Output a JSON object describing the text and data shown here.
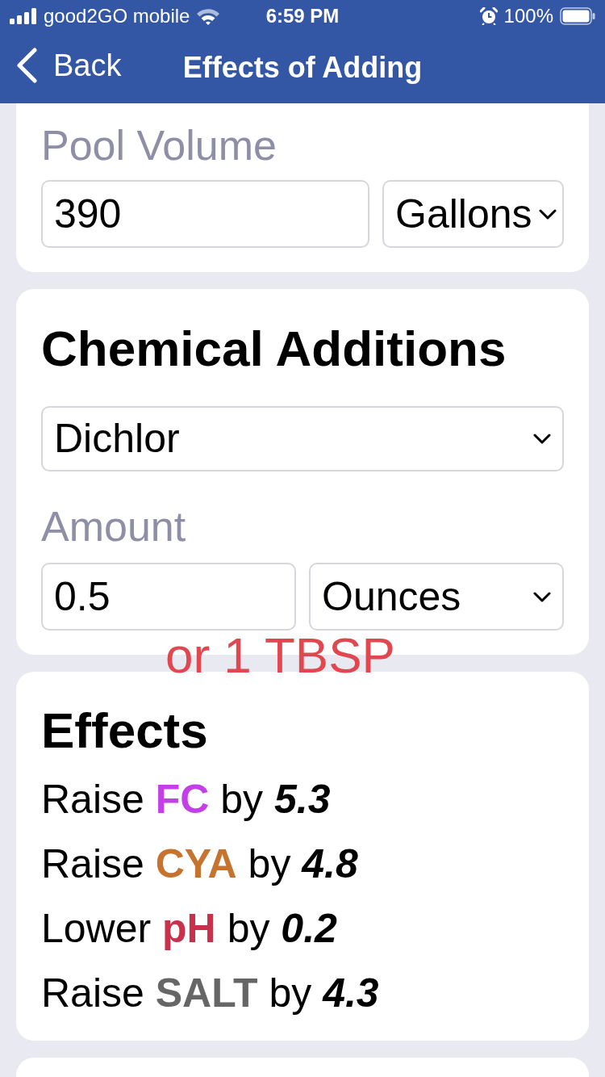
{
  "status_bar": {
    "carrier": "good2GO mobile",
    "time": "6:59 PM",
    "battery": "100%"
  },
  "nav_bar": {
    "back": "Back",
    "title": "Effects of Adding"
  },
  "pool_volume": {
    "label": "Pool Volume",
    "value": "390",
    "unit": "Gallons"
  },
  "chemical_additions": {
    "title": "Chemical Additions",
    "chemical": "Dichlor",
    "amount_label": "Amount",
    "amount": "0.5",
    "unit": "Ounces",
    "hint": "or 1 TBSP"
  },
  "effects": {
    "title": "Effects",
    "items": [
      {
        "verb": "Raise",
        "parameter": "FC",
        "color": "#c33fe8",
        "connector": "by",
        "amount": "5.3"
      },
      {
        "verb": "Raise",
        "parameter": "CYA",
        "color": "#c6732f",
        "connector": "by",
        "amount": "4.8"
      },
      {
        "verb": "Lower",
        "parameter": "pH",
        "color": "#c8314b",
        "connector": "by",
        "amount": "0.2"
      },
      {
        "verb": "Raise",
        "parameter": "SALT",
        "color": "#666666",
        "connector": "by",
        "amount": "4.3"
      }
    ]
  }
}
